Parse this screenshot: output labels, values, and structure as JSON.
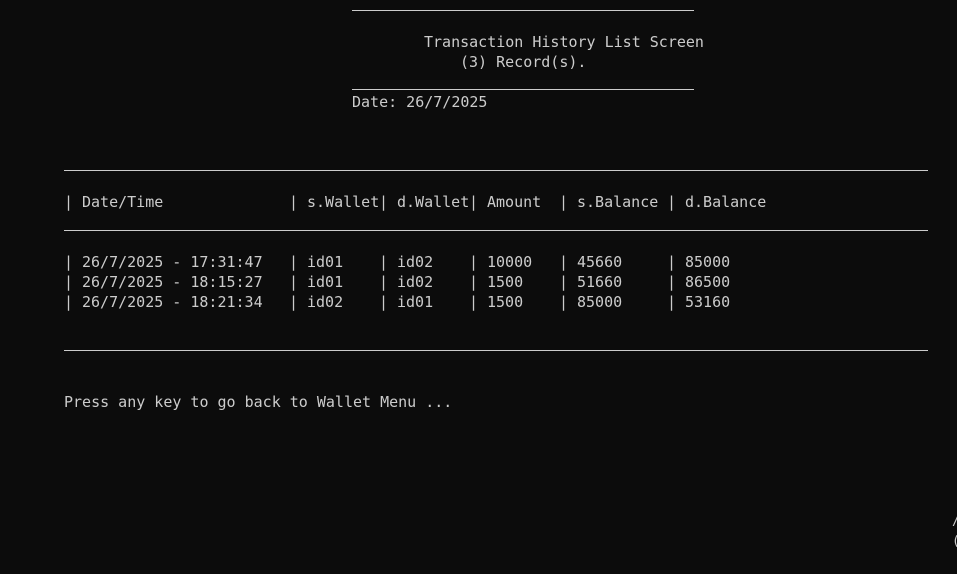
{
  "screen": {
    "title": "Transaction History List Screen",
    "record_count": "(3) Record(s).",
    "date_line": "Date: 26/7/2025"
  },
  "table": {
    "separator": "|",
    "headers": [
      "Date/Time",
      "s.Wallet",
      "d.Wallet",
      "Amount",
      "s.Balance",
      "d.Balance"
    ],
    "rows": [
      [
        "26/7/2025 - 17:31:47",
        "id01",
        "id02",
        "10000",
        "45660",
        "85000"
      ],
      [
        "26/7/2025 - 18:15:27",
        "id01",
        "id02",
        "1500",
        "51660",
        "86500"
      ],
      [
        "26/7/2025 - 18:21:34",
        "id02",
        "id01",
        "1500",
        "85000",
        "53160"
      ]
    ]
  },
  "footer": {
    "prompt": "Press any key to go back to Wallet Menu ..."
  },
  "edge": {
    "glyph_top": "/",
    "glyph_bottom": "("
  },
  "colors": {
    "background": "#0c0c0c",
    "text": "#cccccc"
  }
}
